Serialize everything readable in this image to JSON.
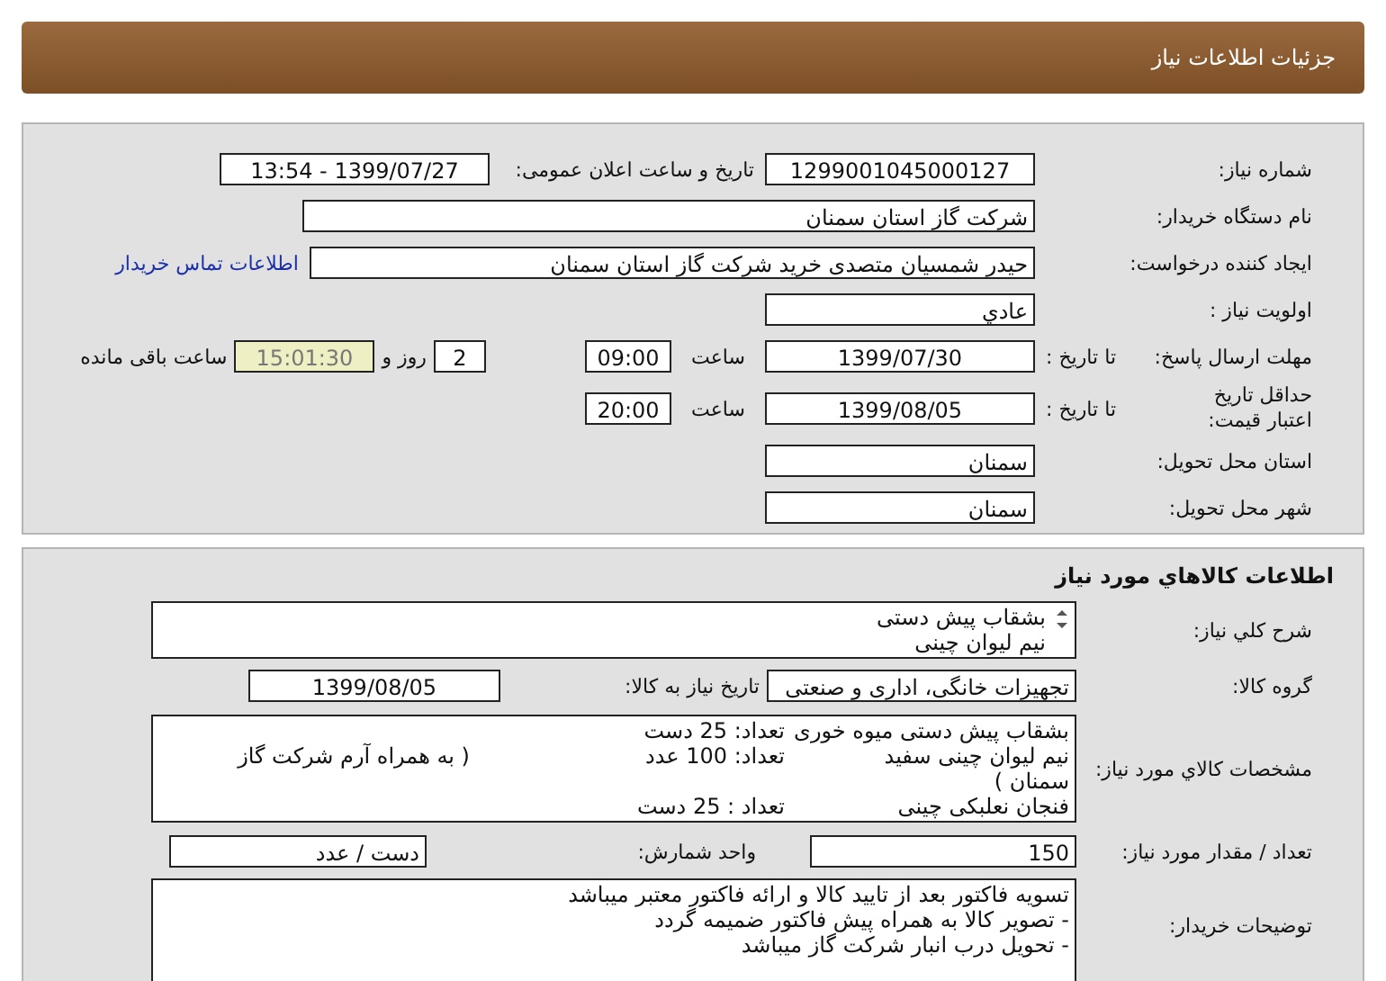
{
  "header": {
    "title": "جزئیات اطلاعات نیاز"
  },
  "need_info": {
    "need_number": {
      "label": "شماره نیاز:",
      "value": "1299001045000127"
    },
    "announce": {
      "label": "تاریخ و ساعت اعلان عمومی:",
      "value": "1399/07/27 - 13:54"
    },
    "buyer": {
      "label": "نام دستگاه خریدار:",
      "value": "شرکت گاز استان سمنان"
    },
    "creator": {
      "label": "ایجاد کننده درخواست:",
      "value": "حیدر شمسیان متصدی خرید شرکت گاز استان سمنان"
    },
    "contact_link": "اطلاعات تماس خریدار",
    "priority": {
      "label": "اولویت نیاز :",
      "value": "عادي"
    },
    "deadline": {
      "label": "مهلت ارسال پاسخ:",
      "date_label": "تا تاریخ :",
      "date": "1399/07/30",
      "time_label": "ساعت",
      "time": "09:00",
      "days": "2",
      "days_label": "روز و",
      "remaining": "15:01:30",
      "remaining_label": "ساعت باقی مانده"
    },
    "validity": {
      "label": "حداقل تاریخ اعتبار قیمت:",
      "date_label": "تا تاریخ :",
      "date": "1399/08/05",
      "time_label": "ساعت",
      "time": "20:00"
    },
    "province": {
      "label": "استان محل تحویل:",
      "value": "سمنان"
    },
    "city": {
      "label": "شهر محل تحویل:",
      "value": "سمنان"
    }
  },
  "goods": {
    "title": "اطلاعات کالاهاي مورد نیاز",
    "summary": {
      "label": "شرح کلي نیاز:",
      "lines": [
        "بشقاب پیش دستی",
        "نیم لیوان چینی"
      ]
    },
    "group": {
      "label": "گروه کالا:",
      "value": "تجهیزات خانگی، اداری و صنعتی"
    },
    "need_date": {
      "label": "تاریخ نیاز به کالا:",
      "value": "1399/08/05"
    },
    "specs": {
      "label": "مشخصات کالاي مورد نیاز:",
      "lines": [
        [
          "بشقاب پیش دستی میوه خوری",
          "تعداد: 25 دست"
        ],
        [
          "نیم لیوان چینی سفید",
          "تعداد: 100 عدد",
          "( به همراه آرم شرکت گاز"
        ],
        [
          "سمنان )"
        ],
        [
          "فنجان نعلبکی چینی",
          "تعداد : 25 دست"
        ]
      ]
    },
    "quantity": {
      "label": "تعداد / مقدار مورد نیاز:",
      "value": "150"
    },
    "unit": {
      "label": "واحد شمارش:",
      "value": "دست / عدد"
    },
    "notes": {
      "label": "توضیحات خریدار:",
      "lines": [
        "تسویه فاکتور بعد از تایید کالا و ارائه فاکتور معتبر میباشد",
        "- تصویر کالا به همراه پیش فاکتور ضمیمه گردد",
        "- تحویل درب انبار شرکت گاز میباشد"
      ]
    }
  }
}
